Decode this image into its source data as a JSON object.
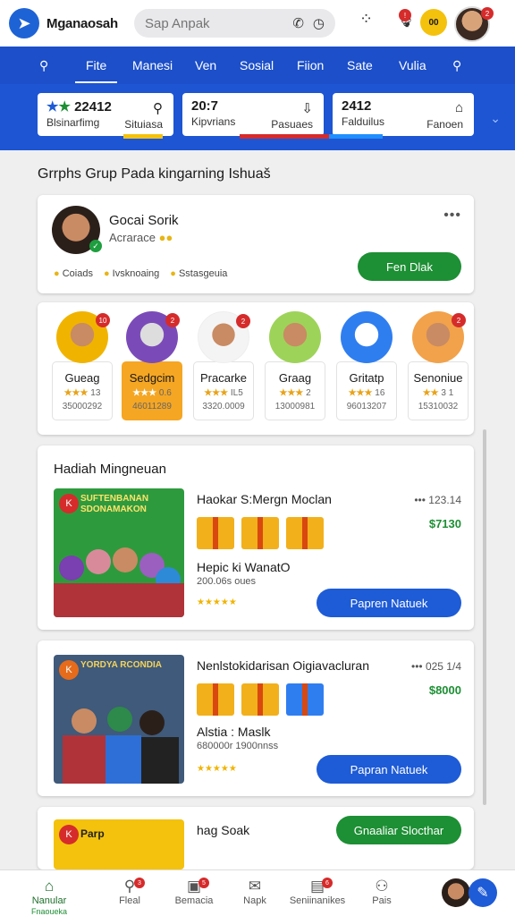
{
  "app": {
    "title": "Mganaosah",
    "search_placeholder": "Sap Anpak",
    "coin": "00"
  },
  "nav": [
    "Fite",
    "Manesi",
    "Ven",
    "Sosial",
    "Fiion",
    "Sate",
    "Vulia"
  ],
  "stats": [
    {
      "value": "22412",
      "label": "Blsinarfimg",
      "aux": "Situiasa"
    },
    {
      "value": "20:7",
      "label": "Kipvrians",
      "aux": "Pasuaes"
    },
    {
      "value": "2412",
      "label": "Falduilus",
      "aux": "Fanoen"
    }
  ],
  "section_title": "Grrphs Grup Pada kingarning Ishuaš",
  "profile": {
    "name": "Gocai Sorik",
    "subtitle": "Acrarace",
    "tags": [
      "Coiads",
      "Ivsknoaing",
      "Sstasgeuia"
    ],
    "button": "Fen Dlak"
  },
  "apps": [
    {
      "name": "Gueag",
      "rating": "13",
      "count": "35000292",
      "badge": "10",
      "color": "#f0b400"
    },
    {
      "name": "Sedgcim",
      "rating": "0.6",
      "count": "46011289",
      "badge": "2",
      "color": "#7a4bb8"
    },
    {
      "name": "Pracarke",
      "rating": "IL5",
      "count": "3320.0009",
      "badge": "2",
      "color": "#f4f4f4"
    },
    {
      "name": "Graag",
      "rating": "2",
      "count": "13000981",
      "badge": "",
      "color": "#9ed35a"
    },
    {
      "name": "Gritatp",
      "rating": "16",
      "count": "96013207",
      "badge": "",
      "color": "#2f7ef0"
    },
    {
      "name": "Senoniue",
      "rating": "3 1",
      "count": "15310032",
      "badge": "2",
      "color": "#f2a24a"
    }
  ],
  "rewards_title": "Hadiah Mingneuan",
  "rewards": [
    {
      "title": "Haokar S:Mergn Moclan",
      "meta": "123.14",
      "price": "$7130",
      "name": "Hepic ki WanatO",
      "sub": "200.06s oues",
      "button": "Papren Natuek",
      "thumb_caption": "SUFTENBANAN SDONAMAKON"
    },
    {
      "title": "Nenlstokidarisan Oigiavacluran",
      "meta": "025 1/4",
      "price": "$8000",
      "name": "Alstia : Maslk",
      "sub": "680000r 1900nnss",
      "button": "Papran Natuek",
      "thumb_caption": "YORDYA RCONDIA"
    },
    {
      "title": "hag Soak",
      "button": "Gnaaliar Slocthar",
      "thumb_caption": "Parp"
    }
  ],
  "bottom_nav": [
    {
      "label": "Nanular",
      "sub": "Fnaoueka",
      "badge": ""
    },
    {
      "label": "Fleal",
      "badge": "3"
    },
    {
      "label": "Bemacia",
      "badge": "5"
    },
    {
      "label": "Napk",
      "badge": ""
    },
    {
      "label": "Seniinanikes",
      "badge": "6"
    },
    {
      "label": "Pais",
      "badge": ""
    }
  ],
  "colors": {
    "primary": "#1c4fc9",
    "green": "#1d8f34",
    "gold": "#f5a623"
  }
}
